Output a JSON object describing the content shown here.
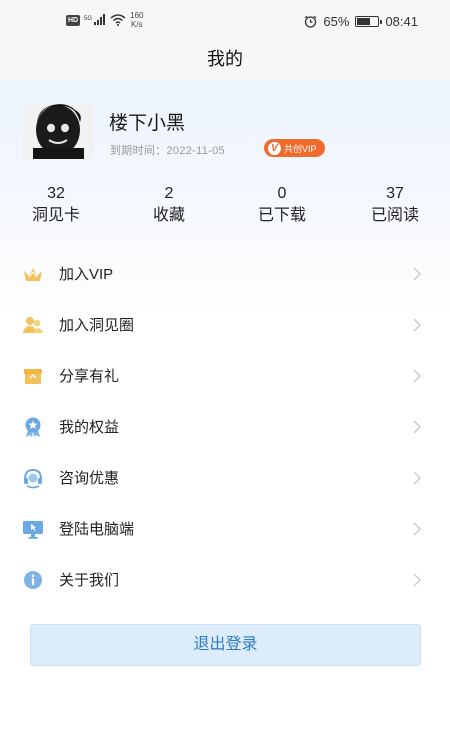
{
  "status_bar": {
    "network_badge": "HD",
    "signal_label": "5G",
    "net_speed_value": "160",
    "net_speed_unit": "K/s",
    "battery_percent": "65%",
    "battery_level": 0.65,
    "time": "08:41"
  },
  "header": {
    "title": "我的"
  },
  "profile": {
    "username": "楼下小黑",
    "expiry_text": "到期时间：2022-11-05",
    "vip_badge_label": "共创VIP",
    "vip_badge_mark": "V"
  },
  "stats": [
    {
      "value": "32",
      "label": "洞见卡"
    },
    {
      "value": "2",
      "label": "收藏"
    },
    {
      "value": "0",
      "label": "已下载"
    },
    {
      "value": "37",
      "label": "已阅读"
    }
  ],
  "menu": [
    {
      "label": "加入VIP",
      "icon": "crown-icon"
    },
    {
      "label": "加入洞见圈",
      "icon": "people-icon"
    },
    {
      "label": "分享有礼",
      "icon": "gift-icon"
    },
    {
      "label": "我的权益",
      "icon": "medal-icon"
    },
    {
      "label": "咨询优惠",
      "icon": "headset-icon"
    },
    {
      "label": "登陆电脑端",
      "icon": "monitor-icon"
    },
    {
      "label": "关于我们",
      "icon": "info-icon"
    }
  ],
  "logout_label": "退出登录",
  "colors": {
    "accent": "#2d7cc1",
    "vip_orange": "#f06a2b",
    "icon_yellow": "#f4c25a",
    "icon_blue": "#6aa9e4"
  }
}
